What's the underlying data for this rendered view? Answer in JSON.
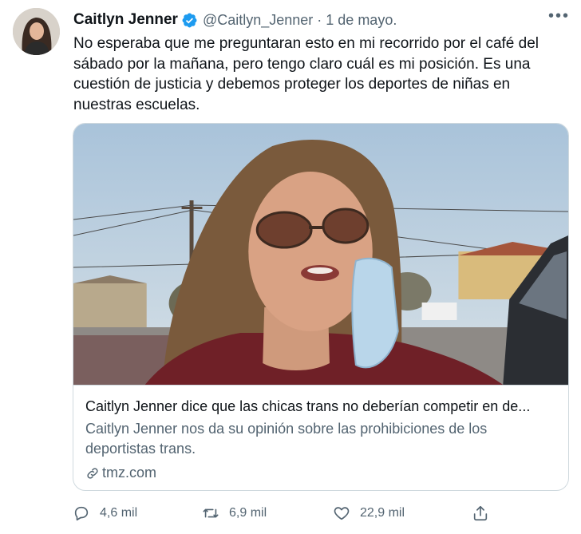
{
  "author": {
    "name": "Caitlyn Jenner",
    "handle": "@Caitlyn_Jenner",
    "separator": "·",
    "date": "1 de mayo."
  },
  "tweet": {
    "text": "No esperaba que me preguntaran esto en mi recorrido por el café del sábado por la mañana, pero tengo claro cuál es mi posición. Es una cuestión de justicia y debemos proteger los deportes de niñas en nuestras escuelas."
  },
  "card": {
    "title": "Caitlyn Jenner dice que las chicas trans no deberían competir en de...",
    "description": "Caitlyn Jenner nos da su opinión sobre las prohibiciones de los deportistas trans.",
    "domain": "tmz.com"
  },
  "actions": {
    "replies": "4,6 mil",
    "retweets": "6,9 mil",
    "likes": "22,9 mil"
  },
  "icons": {
    "more": "more-icon",
    "verified": "verified-badge-icon",
    "reply": "reply-icon",
    "retweet": "retweet-icon",
    "like": "heart-icon",
    "share": "share-icon",
    "link": "link-icon"
  },
  "colors": {
    "verified": "#1d9bf0",
    "secondary_text": "#536471",
    "primary_text": "#0f1419",
    "border": "#cfd9de"
  }
}
